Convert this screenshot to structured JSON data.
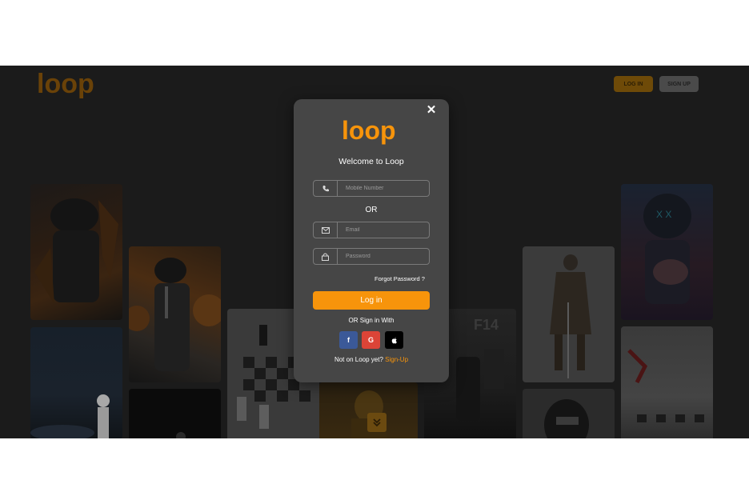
{
  "header": {
    "brand": "loop",
    "login_label": "LOG IN",
    "signup_label": "SIGN UP"
  },
  "modal": {
    "brand": "loop",
    "close_label": "✕",
    "title": "Welcome to Loop",
    "mobile_placeholder": "Mobile Number",
    "or_label": "OR",
    "email_placeholder": "Email",
    "password_placeholder": "Password",
    "forgot_label": "Forgot Password ?",
    "login_label": "Log in",
    "or_sign_in_with": "OR Sign in With",
    "social": [
      {
        "name": "facebook",
        "glyph": "f",
        "color": "#3b5998"
      },
      {
        "name": "google",
        "glyph": "G",
        "color": "#db4437"
      },
      {
        "name": "apple",
        "glyph": "",
        "color": "#000000"
      }
    ],
    "signup_prompt": "Not on Loop yet?",
    "signup_link": "Sign-Up"
  },
  "background_tiles": {
    "scroll_icon": "chevron-double-down-icon",
    "tile_text": "F14"
  },
  "colors": {
    "accent": "#f7940b",
    "modal_bg": "#464646",
    "page_bg": "#1b1b1b"
  }
}
